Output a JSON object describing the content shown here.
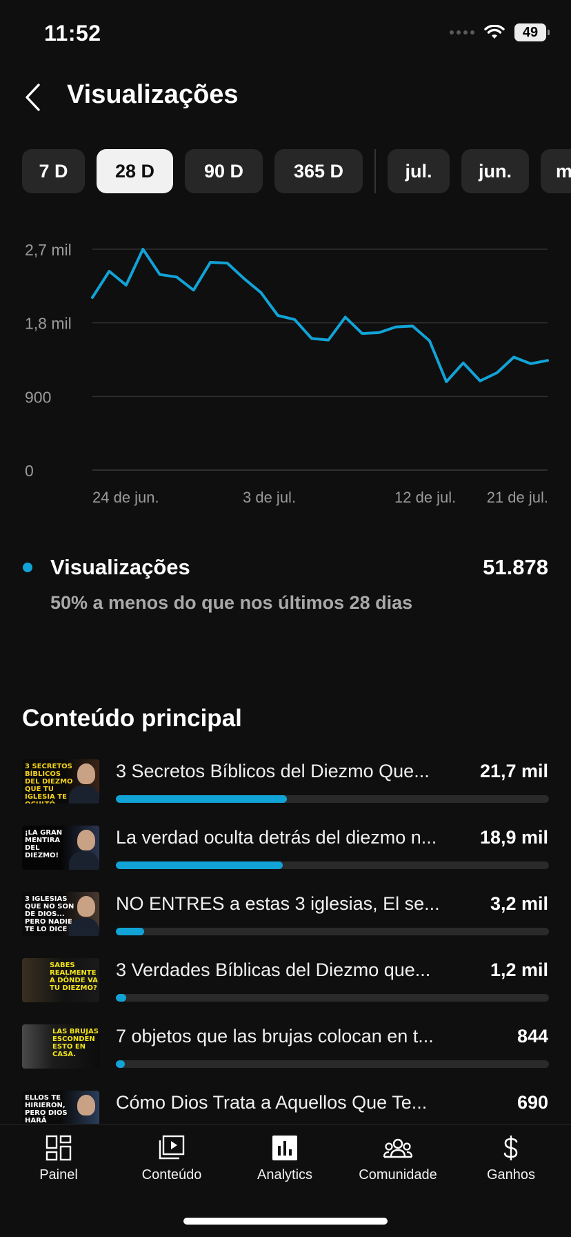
{
  "status_bar": {
    "time": "11:52",
    "battery": "49",
    "icons": [
      "signal-dots-icon",
      "wifi-icon",
      "battery-icon"
    ]
  },
  "header": {
    "title": "Visualizações",
    "back_icon": "chevron-left-icon"
  },
  "period_chips": [
    {
      "label": "7 D",
      "selected": false
    },
    {
      "label": "28 D",
      "selected": true
    },
    {
      "label": "90 D",
      "selected": false
    },
    {
      "label": "365 D",
      "selected": false
    },
    {
      "label": "jul.",
      "selected": false
    },
    {
      "label": "jun.",
      "selected": false
    },
    {
      "label": "m",
      "selected": false
    }
  ],
  "chart_data": {
    "type": "line",
    "title": "",
    "xlabel": "",
    "ylabel": "",
    "ylim": [
      0,
      2700
    ],
    "y_ticks": [
      {
        "value": 0,
        "label": "0"
      },
      {
        "value": 900,
        "label": "900"
      },
      {
        "value": 1800,
        "label": "1,8 mil"
      },
      {
        "value": 2700,
        "label": "2,7 mil"
      }
    ],
    "x_ticks": [
      {
        "index": 0,
        "label": "24 de jun."
      },
      {
        "index": 9,
        "label": "3 de jul."
      },
      {
        "index": 18,
        "label": "12 de jul."
      },
      {
        "index": 27,
        "label": "21 de jul."
      }
    ],
    "grid": true,
    "color": "#12a3d6",
    "series": [
      {
        "values": [
          2110,
          2430,
          2260,
          2700,
          2390,
          2360,
          2200,
          2540,
          2530,
          2340,
          2170,
          1890,
          1840,
          1610,
          1590,
          1870,
          1670,
          1680,
          1750,
          1760,
          1580,
          1080,
          1310,
          1090,
          1190,
          1380,
          1300,
          1340
        ]
      }
    ]
  },
  "summary": {
    "label": "Visualizações",
    "value": "51.878",
    "comparison": "50% a menos do que nos últimos 28 dias",
    "dot_color": "#12a3d6"
  },
  "top_content": {
    "title": "Conteúdo principal",
    "items": [
      {
        "title": "3 Secretos Bíblicos del Diezmo Que...",
        "value": "21,7 mil",
        "share": 0.395,
        "thumb_caption": "3 Secretos bíblicos del diezmo que tu iglesia te ocultó"
      },
      {
        "title": "La verdad oculta detrás del diezmo n...",
        "value": "18,9 mil",
        "share": 0.385,
        "thumb_caption": "¡La gran mentira del diezmo!"
      },
      {
        "title": "NO ENTRES a estas 3 iglesias,  El se...",
        "value": "3,2 mil",
        "share": 0.065,
        "thumb_caption": "3 iglesias que no son de Dios... pero nadie te lo dice"
      },
      {
        "title": "3 Verdades Bíblicas del Diezmo que...",
        "value": "1,2 mil",
        "share": 0.024,
        "thumb_caption": "Sabes realmente a dónde va tu diezmo?"
      },
      {
        "title": "7 objetos que las brujas colocan en t...",
        "value": "844",
        "share": 0.016,
        "thumb_caption": "Las brujas esconden esto en casa."
      },
      {
        "title": "Cómo Dios Trata a Aquellos Que Te...",
        "value": "690",
        "share": 0.013,
        "thumb_caption": "Ellos te hirieron, pero Dios hará justicia"
      }
    ]
  },
  "bottom_nav": [
    {
      "label": "Painel",
      "icon": "dashboard-icon",
      "active": false
    },
    {
      "label": "Conteúdo",
      "icon": "content-icon",
      "active": false
    },
    {
      "label": "Analytics",
      "icon": "analytics-icon",
      "active": true
    },
    {
      "label": "Comunidade",
      "icon": "community-icon",
      "active": false
    },
    {
      "label": "Ganhos",
      "icon": "dollar-icon",
      "active": false
    }
  ]
}
